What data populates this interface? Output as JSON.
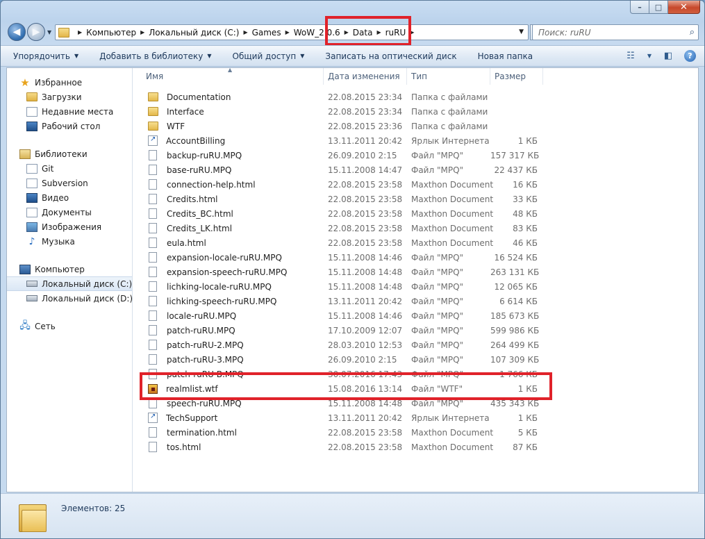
{
  "window": {
    "caption": {
      "min": "–",
      "max": "□",
      "close": "✕"
    }
  },
  "address": {
    "crumbs": [
      "Компьютер",
      "Локальный диск (C:)",
      "Games",
      "WoW_2.0.6",
      "Data",
      "ruRU"
    ]
  },
  "search": {
    "placeholder": "Поиск: ruRU"
  },
  "toolbar": {
    "organize": "Упорядочить",
    "add_library": "Добавить в библиотеку",
    "share": "Общий доступ",
    "burn": "Записать на оптический диск",
    "new_folder": "Новая папка"
  },
  "nav": {
    "favorites": {
      "header": "Избранное",
      "items": [
        "Загрузки",
        "Недавние места",
        "Рабочий стол"
      ]
    },
    "libraries": {
      "header": "Библиотеки",
      "items": [
        "Git",
        "Subversion",
        "Видео",
        "Документы",
        "Изображения",
        "Музыка"
      ]
    },
    "computer": {
      "header": "Компьютер",
      "items": [
        "Локальный диск (C:)",
        "Локальный диск (D:)"
      ]
    },
    "network": {
      "header": "Сеть"
    }
  },
  "columns": {
    "name": "Имя",
    "date": "Дата изменения",
    "type": "Тип",
    "size": "Размер"
  },
  "files": [
    {
      "name": "Documentation",
      "date": "22.08.2015 23:34",
      "type": "Папка с файлами",
      "size": "",
      "icon": "folder-icon"
    },
    {
      "name": "Interface",
      "date": "22.08.2015 23:34",
      "type": "Папка с файлами",
      "size": "",
      "icon": "folder-icon"
    },
    {
      "name": "WTF",
      "date": "22.08.2015 23:36",
      "type": "Папка с файлами",
      "size": "",
      "icon": "folder-icon"
    },
    {
      "name": "AccountBilling",
      "date": "13.11.2011 20:42",
      "type": "Ярлык Интернета",
      "size": "1 КБ",
      "icon": "internet-shortcut-icon"
    },
    {
      "name": "backup-ruRU.MPQ",
      "date": "26.09.2010 2:15",
      "type": "Файл \"MPQ\"",
      "size": "157 317 КБ",
      "icon": "file-icon"
    },
    {
      "name": "base-ruRU.MPQ",
      "date": "15.11.2008 14:47",
      "type": "Файл \"MPQ\"",
      "size": "22 437 КБ",
      "icon": "file-icon"
    },
    {
      "name": "connection-help.html",
      "date": "22.08.2015 23:58",
      "type": "Maxthon Document",
      "size": "16 КБ",
      "icon": "file-icon"
    },
    {
      "name": "Credits.html",
      "date": "22.08.2015 23:58",
      "type": "Maxthon Document",
      "size": "33 КБ",
      "icon": "file-icon"
    },
    {
      "name": "Credits_BC.html",
      "date": "22.08.2015 23:58",
      "type": "Maxthon Document",
      "size": "48 КБ",
      "icon": "file-icon"
    },
    {
      "name": "Credits_LK.html",
      "date": "22.08.2015 23:58",
      "type": "Maxthon Document",
      "size": "83 КБ",
      "icon": "file-icon"
    },
    {
      "name": "eula.html",
      "date": "22.08.2015 23:58",
      "type": "Maxthon Document",
      "size": "46 КБ",
      "icon": "file-icon"
    },
    {
      "name": "expansion-locale-ruRU.MPQ",
      "date": "15.11.2008 14:46",
      "type": "Файл \"MPQ\"",
      "size": "16 524 КБ",
      "icon": "file-icon"
    },
    {
      "name": "expansion-speech-ruRU.MPQ",
      "date": "15.11.2008 14:48",
      "type": "Файл \"MPQ\"",
      "size": "263 131 КБ",
      "icon": "file-icon"
    },
    {
      "name": "lichking-locale-ruRU.MPQ",
      "date": "15.11.2008 14:48",
      "type": "Файл \"MPQ\"",
      "size": "12 065 КБ",
      "icon": "file-icon"
    },
    {
      "name": "lichking-speech-ruRU.MPQ",
      "date": "13.11.2011 20:42",
      "type": "Файл \"MPQ\"",
      "size": "6 614 КБ",
      "icon": "file-icon"
    },
    {
      "name": "locale-ruRU.MPQ",
      "date": "15.11.2008 14:46",
      "type": "Файл \"MPQ\"",
      "size": "185 673 КБ",
      "icon": "file-icon"
    },
    {
      "name": "patch-ruRU.MPQ",
      "date": "17.10.2009 12:07",
      "type": "Файл \"MPQ\"",
      "size": "599 986 КБ",
      "icon": "file-icon"
    },
    {
      "name": "patch-ruRU-2.MPQ",
      "date": "28.03.2010 12:53",
      "type": "Файл \"MPQ\"",
      "size": "264 499 КБ",
      "icon": "file-icon"
    },
    {
      "name": "patch-ruRU-3.MPQ",
      "date": "26.09.2010 2:15",
      "type": "Файл \"MPQ\"",
      "size": "107 309 КБ",
      "icon": "file-icon"
    },
    {
      "name": "patch-ruRU-B.MPQ",
      "date": "30.07.2016 17:43",
      "type": "Файл \"MPQ\"",
      "size": "1 766 КБ",
      "icon": "file-icon"
    },
    {
      "name": "realmlist.wtf",
      "date": "15.08.2016 13:14",
      "type": "Файл \"WTF\"",
      "size": "1 КБ",
      "icon": "wtf-file-icon"
    },
    {
      "name": "speech-ruRU.MPQ",
      "date": "15.11.2008 14:48",
      "type": "Файл \"MPQ\"",
      "size": "435 343 КБ",
      "icon": "file-icon"
    },
    {
      "name": "TechSupport",
      "date": "13.11.2011 20:42",
      "type": "Ярлык Интернета",
      "size": "1 КБ",
      "icon": "internet-shortcut-icon"
    },
    {
      "name": "termination.html",
      "date": "22.08.2015 23:58",
      "type": "Maxthon Document",
      "size": "5 КБ",
      "icon": "file-icon"
    },
    {
      "name": "tos.html",
      "date": "22.08.2015 23:58",
      "type": "Maxthon Document",
      "size": "87 КБ",
      "icon": "file-icon"
    }
  ],
  "status": {
    "items_count": "Элементов: 25"
  },
  "colors": {
    "highlight": "#e0222a",
    "chrome": "#c6daef",
    "accent": "#1e395b"
  }
}
